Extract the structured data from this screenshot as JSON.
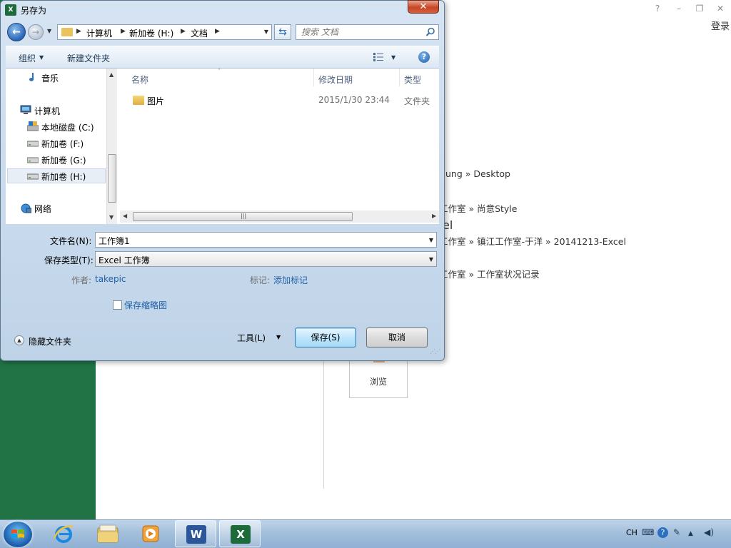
{
  "window": {
    "title": "另存为"
  },
  "background": {
    "login": "登录",
    "help": "?",
    "minimize": "–",
    "restore": "❐",
    "close": "✕",
    "paths": [
      "ung » Desktop",
      "› 工作室 » 尚意Style",
      "› 工作室 » 镇江工作室-于洋 » 20141213-Excel",
      "› 工作室 » 工作室状况记录"
    ],
    "partial_title": "el",
    "browse_label": "浏览"
  },
  "nav": {
    "breadcrumbs": [
      "计算机",
      "新加卷 (H:)",
      "文档"
    ],
    "search_placeholder": "搜索 文档"
  },
  "toolbar": {
    "organize": "组织",
    "new_folder": "新建文件夹"
  },
  "sidebar": {
    "items": [
      {
        "label": "音乐"
      },
      {
        "label": "计算机"
      },
      {
        "label": "本地磁盘 (C:)"
      },
      {
        "label": "新加卷 (F:)"
      },
      {
        "label": "新加卷 (G:)"
      },
      {
        "label": "新加卷 (H:)"
      },
      {
        "label": "网络"
      }
    ]
  },
  "file_list": {
    "columns": {
      "name": "名称",
      "modified": "修改日期",
      "type": "类型"
    },
    "rows": [
      {
        "name": "图片",
        "modified": "2015/1/30 23:44",
        "type": "文件夹"
      }
    ]
  },
  "form": {
    "filename_label": "文件名(N):",
    "filename_value": "工作簿1",
    "filetype_label": "保存类型(T):",
    "filetype_value": "Excel 工作簿",
    "author_label": "作者:",
    "author_value": "takepic",
    "tags_label": "标记:",
    "tags_value": "添加标记",
    "save_thumbnail": "保存缩略图",
    "hide_folders": "隐藏文件夹",
    "tools": "工具(L)",
    "save": "保存(S)",
    "cancel": "取消"
  },
  "taskbar": {
    "language": "CH",
    "word_letter": "W",
    "excel_letter": "X"
  },
  "colors": {
    "excel_green": "#217346",
    "link_blue": "#1e5fa8",
    "word_blue": "#2b579a"
  }
}
